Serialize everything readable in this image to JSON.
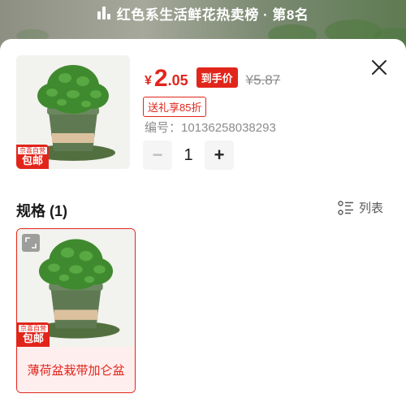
{
  "banner": {
    "text": "红色系生活鲜花热卖榜 · 第8名"
  },
  "product": {
    "price_symbol": "¥",
    "price_int": "2",
    "price_dec": ".05",
    "price_tag": "到手价",
    "original_price": "¥5.87",
    "gift_tag": "送礼享85折",
    "sku_code": "编号：10136258038293",
    "quantity": "1",
    "badge_small": "京喜自营",
    "badge_big": "包邮"
  },
  "specs": {
    "title": "规格 (1)",
    "view_toggle": "列表",
    "items": [
      {
        "label": "薄荷盆栽带加仑盆",
        "badge_small": "京喜自营",
        "badge_big": "包邮"
      }
    ]
  },
  "colors": {
    "accent": "#e1251b",
    "pot": "#5f7a52",
    "leaf": "#3f8a2e"
  },
  "icons": {
    "rank": "bar-chart-icon",
    "close": "close-icon",
    "minus": "minus-icon",
    "plus": "plus-icon",
    "list": "list-view-icon",
    "expand": "expand-icon"
  }
}
